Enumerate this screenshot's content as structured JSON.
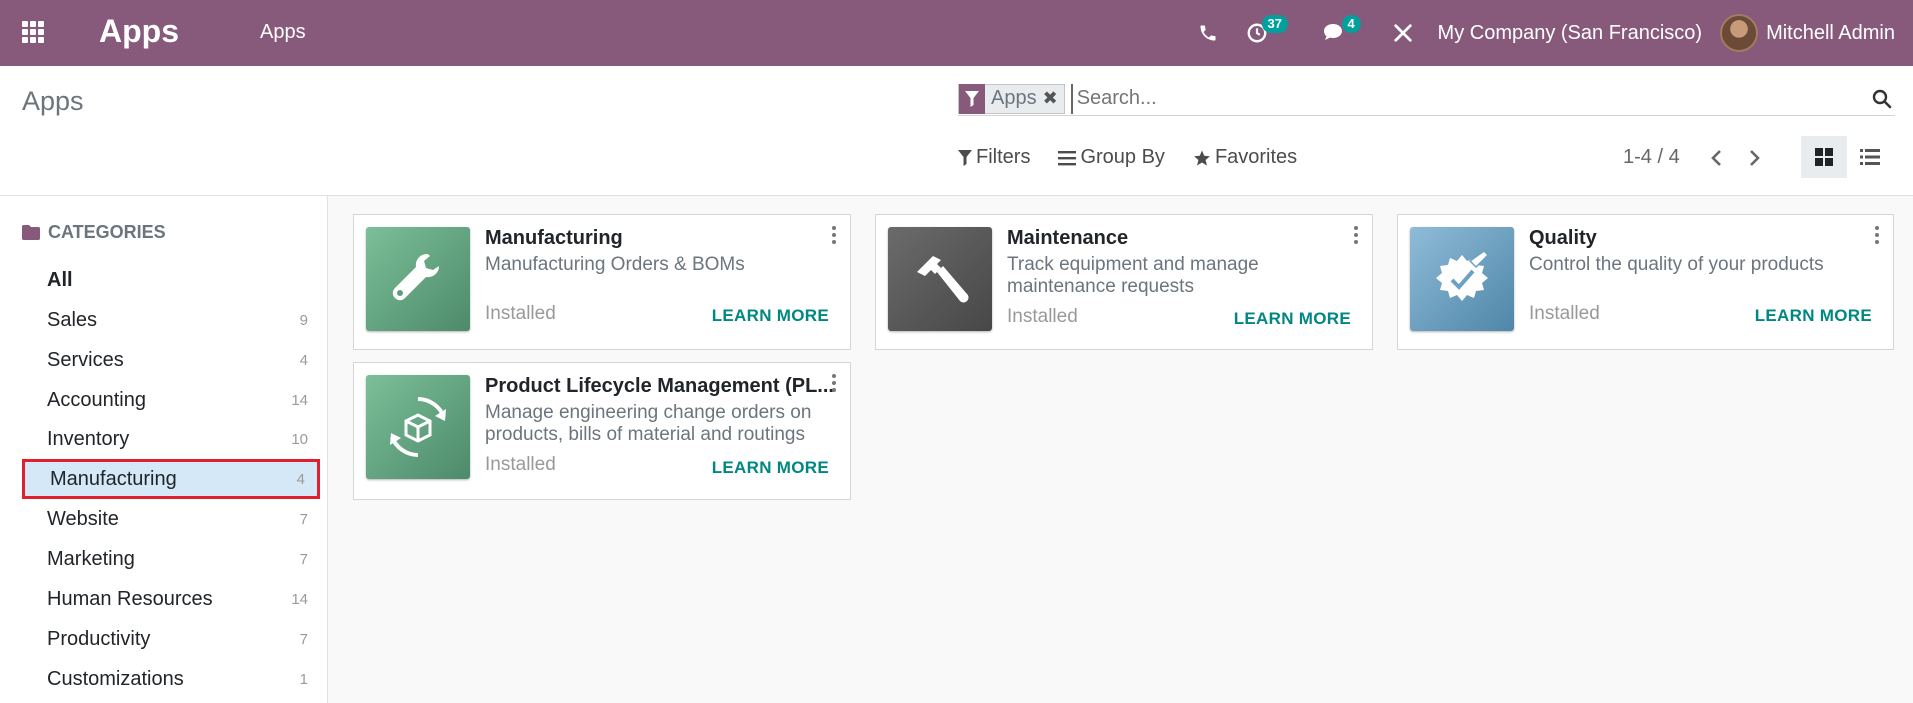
{
  "navbar": {
    "brand": "Apps",
    "menu_item": "Apps",
    "activity_count": "37",
    "message_count": "4",
    "company": "My Company (San Francisco)",
    "user": "Mitchell Admin",
    "icons": [
      "phone-icon",
      "clock-icon",
      "chat-icon",
      "tools-icon"
    ]
  },
  "control": {
    "title": "Apps",
    "facet_label": "Apps",
    "search_placeholder": "Search...",
    "filters_label": "Filters",
    "groupby_label": "Group By",
    "favorites_label": "Favorites",
    "pager": "1-4 / 4",
    "active_view": "kanban"
  },
  "sidebar": {
    "header": "CATEGORIES",
    "items": [
      {
        "label": "All",
        "count": ""
      },
      {
        "label": "Sales",
        "count": "9"
      },
      {
        "label": "Services",
        "count": "4"
      },
      {
        "label": "Accounting",
        "count": "14"
      },
      {
        "label": "Inventory",
        "count": "10"
      },
      {
        "label": "Manufacturing",
        "count": "4"
      },
      {
        "label": "Website",
        "count": "7"
      },
      {
        "label": "Marketing",
        "count": "7"
      },
      {
        "label": "Human Resources",
        "count": "14"
      },
      {
        "label": "Productivity",
        "count": "7"
      },
      {
        "label": "Customizations",
        "count": "1"
      }
    ],
    "active_item": "Manufacturing"
  },
  "apps": [
    {
      "title": "Manufacturing",
      "description": "Manufacturing Orders & BOMs",
      "status": "Installed",
      "action": "LEARN MORE",
      "icon": "wrench-icon",
      "color": "#5f9c7d"
    },
    {
      "title": "Maintenance",
      "description": "Track equipment and manage maintenance requests",
      "status": "Installed",
      "action": "LEARN MORE",
      "icon": "hammer-icon",
      "color": "#5a5a5a"
    },
    {
      "title": "Quality",
      "description": "Control the quality of your products",
      "status": "Installed",
      "action": "LEARN MORE",
      "icon": "quality-badge-icon",
      "color": "#6aa1c4"
    },
    {
      "title": "Product Lifecycle Management (PL...",
      "description": "Manage engineering change orders on products, bills of material and routings",
      "status": "Installed",
      "action": "LEARN MORE",
      "icon": "cycle-box-icon",
      "color": "#5f9c7d"
    }
  ],
  "colors": {
    "navbar": "#875a7b",
    "accent": "#008784",
    "badge": "#00a09d",
    "highlight": "#e0202c"
  }
}
